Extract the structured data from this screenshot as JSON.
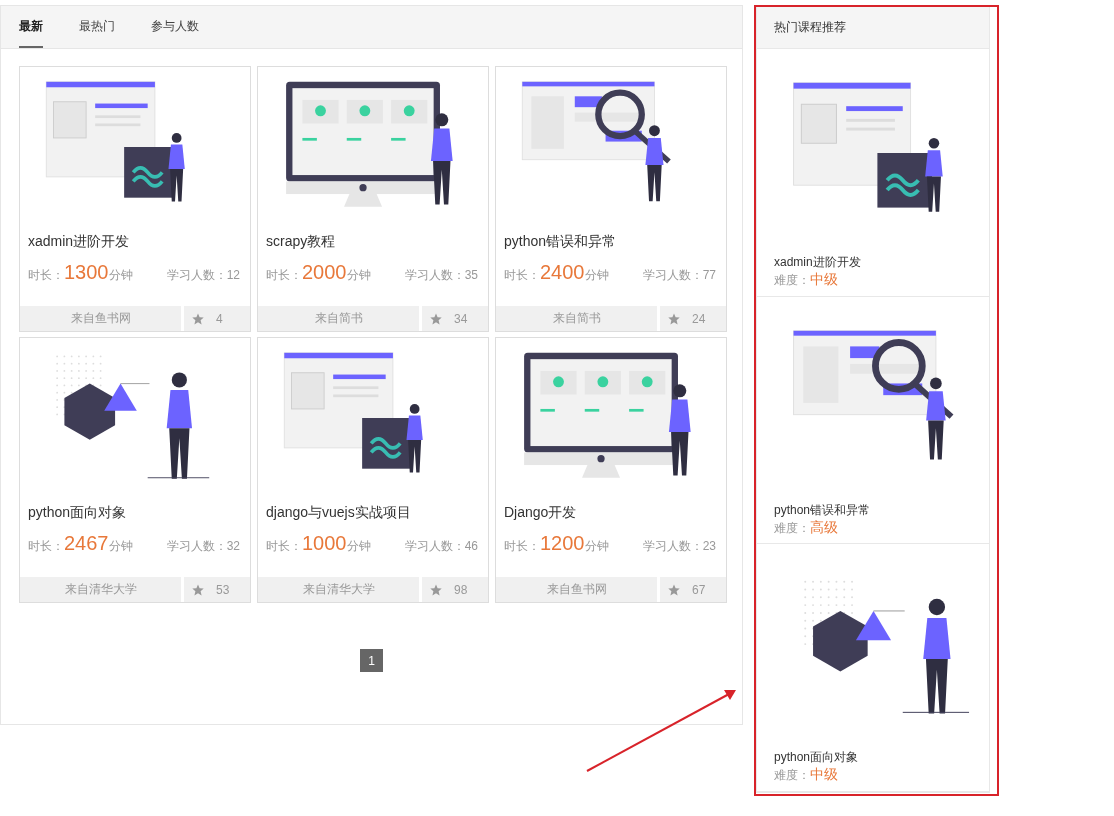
{
  "tabs": [
    {
      "label": "最新",
      "selected": true
    },
    {
      "label": "最热门",
      "selected": false
    },
    {
      "label": "参与人数",
      "selected": false
    }
  ],
  "courses": [
    {
      "kind": "admin",
      "title": "xadmin进阶开发",
      "duration_label": "时长：",
      "duration": "1300",
      "duration_unit": "分钟",
      "learners": "学习人数：12",
      "source": "来自鱼书网",
      "favorites": "4"
    },
    {
      "kind": "monitor",
      "title": "scrapy教程",
      "duration_label": "时长：",
      "duration": "2000",
      "duration_unit": "分钟",
      "learners": "学习人数：35",
      "source": "来自简书",
      "favorites": "34"
    },
    {
      "kind": "search",
      "title": "python错误和异常",
      "duration_label": "时长：",
      "duration": "2400",
      "duration_unit": "分钟",
      "learners": "学习人数：77",
      "source": "来自简书",
      "favorites": "24"
    },
    {
      "kind": "chart",
      "title": "python面向对象",
      "duration_label": "时长：",
      "duration": "2467",
      "duration_unit": "分钟",
      "learners": "学习人数：32",
      "source": "来自清华大学",
      "favorites": "53"
    },
    {
      "kind": "admin",
      "title": "django与vuejs实战项目",
      "duration_label": "时长：",
      "duration": "1000",
      "duration_unit": "分钟",
      "learners": "学习人数：46",
      "source": "来自清华大学",
      "favorites": "98"
    },
    {
      "kind": "monitor",
      "title": "Django开发",
      "duration_label": "时长：",
      "duration": "1200",
      "duration_unit": "分钟",
      "learners": "学习人数：23",
      "source": "来自鱼书网",
      "favorites": "67"
    }
  ],
  "pagination": [
    {
      "label": "1",
      "selected": true
    }
  ],
  "sidebar": {
    "title": "热门课程推荐",
    "items": [
      {
        "kind": "admin",
        "title": "xadmin进阶开发",
        "difficulty_label": "难度：",
        "difficulty": "中级"
      },
      {
        "kind": "search",
        "title": "python错误和异常",
        "difficulty_label": "难度：",
        "difficulty": "高级"
      },
      {
        "kind": "chart",
        "title": "python面向对象",
        "difficulty_label": "难度：",
        "difficulty": "中级"
      }
    ]
  }
}
